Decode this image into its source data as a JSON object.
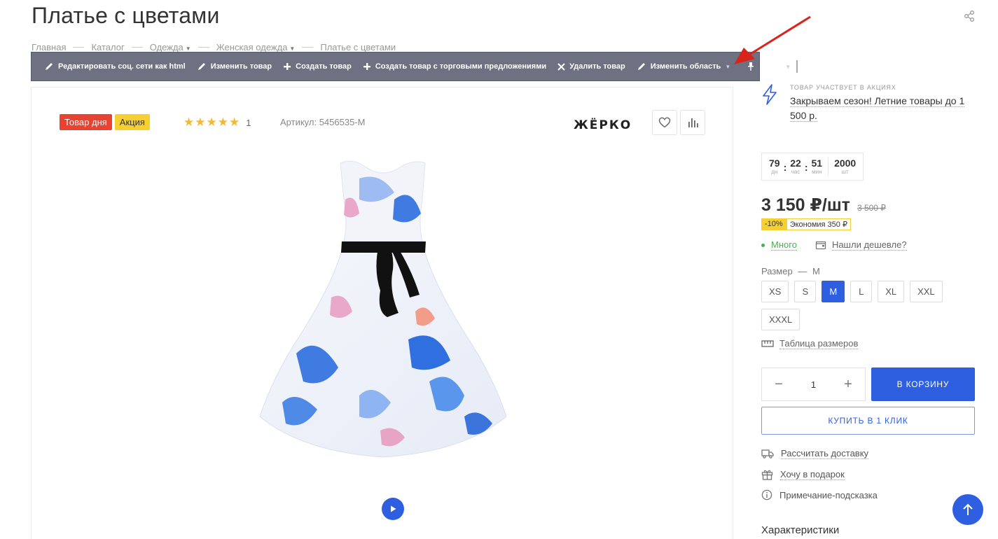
{
  "page": {
    "title": "Платье с цветами"
  },
  "breadcrumb": [
    {
      "label": "Главная",
      "dropdown": false
    },
    {
      "label": "Каталог",
      "dropdown": false
    },
    {
      "label": "Одежда",
      "dropdown": true
    },
    {
      "label": "Женская одежда",
      "dropdown": true
    },
    {
      "label": "Платье с цветами",
      "dropdown": false
    }
  ],
  "admin_bar": {
    "edit_social": "Редактировать соц. сети как html",
    "edit_product": "Изменить товар",
    "create_product": "Создать товар",
    "create_with_offers": "Создать товар с торговыми предложениями",
    "delete_product": "Удалить товар",
    "edit_area": "Изменить область"
  },
  "product": {
    "badge_day": "Товар дня",
    "badge_sale": "Акция",
    "stars": "★★★★★",
    "rating": 5,
    "reviews_count": "1",
    "sku": "Артикул: 5456535-М",
    "brand": "ЖЁРКО"
  },
  "promo": {
    "label": "Товар участвует в акциях",
    "link": "Закрываем сезон! Летние товары до 1 500 р."
  },
  "countdown": [
    {
      "value": "79",
      "unit": "дн"
    },
    {
      "value": "22",
      "unit": "час"
    },
    {
      "value": "51",
      "unit": "мин"
    }
  ],
  "stock_count": {
    "value": "2000",
    "unit": "шт"
  },
  "price": {
    "current": "3 150 ₽/шт",
    "old": "3 500 ₽",
    "discount_pct": "-10%",
    "savings": "Экономия 350 ₽"
  },
  "availability": {
    "status": "Много",
    "cheaper": "Нашли дешевле?"
  },
  "size": {
    "label": "Размер",
    "dash": "—",
    "selected": "M",
    "options": [
      "XS",
      "S",
      "M",
      "L",
      "XL",
      "XXL",
      "XXXL"
    ]
  },
  "size_table": "Таблица размеров",
  "quantity": "1",
  "buttons": {
    "cart": "В КОРЗИНУ",
    "one_click": "КУПИТЬ В 1 КЛИК"
  },
  "services": {
    "delivery": "Рассчитать доставку",
    "gift": "Хочу в подарок",
    "hint": "Примечание-подсказка"
  },
  "characteristics_title": "Характеристики",
  "colors": {
    "accent": "#2e5fe0",
    "sale_badge": "#f7cf30",
    "day_badge": "#e84330",
    "admin_bar": "#6d7182",
    "stock_green": "#4caf50",
    "annotation_arrow": "#d9241c"
  }
}
